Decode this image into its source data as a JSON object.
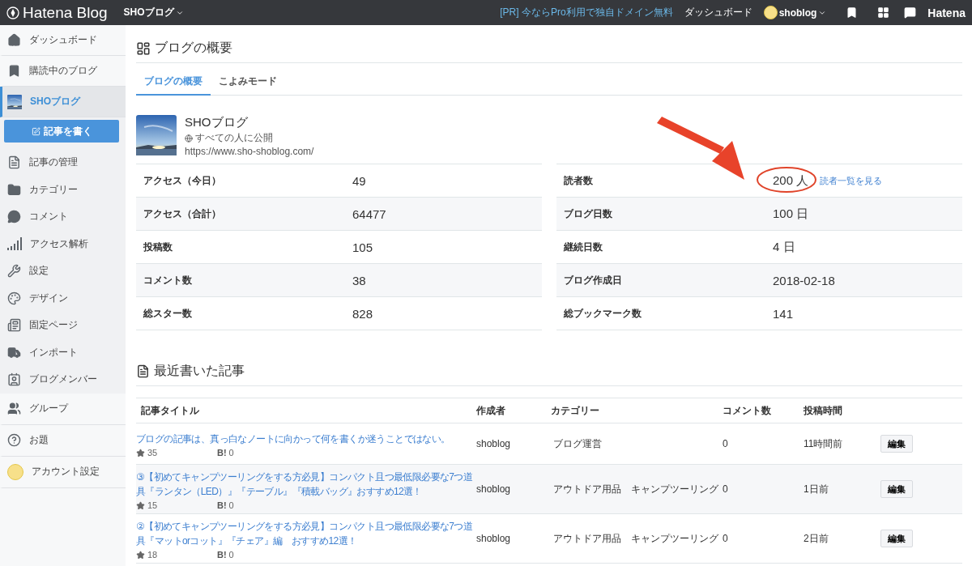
{
  "topbar": {
    "logo": "Hatena Blog",
    "blog_menu": "SHOブログ",
    "promo": "[PR] 今ならPro利用で独自ドメイン無料",
    "dashboard": "ダッシュボード",
    "user": "shoblog",
    "brand": "Hatena"
  },
  "sidebar": {
    "sections": [
      {
        "items": [
          {
            "label": "ダッシュボード",
            "kind": "link",
            "selected": false
          },
          {
            "label": "購読中のブログ",
            "kind": "link",
            "selected": false
          }
        ]
      },
      {
        "items": [
          {
            "label": "SHOブログ",
            "kind": "blog",
            "selected": true
          },
          {
            "label": "記事を書く",
            "kind": "button"
          },
          {
            "label": "記事の管理",
            "kind": "link",
            "selected": false
          },
          {
            "label": "カテゴリー",
            "kind": "link",
            "selected": false
          },
          {
            "label": "コメント",
            "kind": "link",
            "selected": false
          },
          {
            "label": "アクセス解析",
            "kind": "link",
            "selected": false
          },
          {
            "label": "設定",
            "kind": "link",
            "selected": false
          },
          {
            "label": "デザイン",
            "kind": "link",
            "selected": false
          },
          {
            "label": "固定ページ",
            "kind": "link",
            "selected": false
          },
          {
            "label": "インポート",
            "kind": "link",
            "selected": false
          },
          {
            "label": "ブログメンバー",
            "kind": "link",
            "selected": false
          }
        ]
      },
      {
        "items": [
          {
            "label": "グループ",
            "kind": "link",
            "selected": false
          },
          {
            "label": "お題",
            "kind": "link",
            "selected": false
          },
          {
            "label": "アカウント設定",
            "kind": "account",
            "selected": false
          }
        ]
      }
    ]
  },
  "overview": {
    "title": "ブログの概要",
    "tabs": [
      {
        "label": "ブログの概要",
        "selected": true
      },
      {
        "label": "こよみモード",
        "selected": false
      }
    ],
    "blog": {
      "name": "SHOブログ",
      "visibility": "すべての人に公開",
      "url": "https://www.sho-shoblog.com/"
    },
    "stats_left": [
      {
        "label": "アクセス（今日）",
        "value": "49"
      },
      {
        "label": "アクセス（合計）",
        "value": "64477"
      },
      {
        "label": "投稿数",
        "value": "105"
      },
      {
        "label": "コメント数",
        "value": "38"
      },
      {
        "label": "総スター数",
        "value": "828"
      }
    ],
    "stats_right": [
      {
        "label": "読者数",
        "value": "200 人",
        "link": "読者一覧を見る",
        "highlighted": true
      },
      {
        "label": "ブログ日数",
        "value": "100 日",
        "highlighted": false
      },
      {
        "label": "継続日数",
        "value": "4 日",
        "highlighted": false
      },
      {
        "label": "ブログ作成日",
        "value": "2018-02-18",
        "highlighted": false
      },
      {
        "label": "総ブックマーク数",
        "value": "141",
        "highlighted": false
      }
    ]
  },
  "recent": {
    "title": "最近書いた記事",
    "columns": [
      "記事タイトル",
      "作成者",
      "カテゴリー",
      "コメント数",
      "投稿時間"
    ],
    "rows": [
      {
        "title": "ブログの記事は、真っ白なノートに向かって何を書くか迷うことではない。",
        "stars": "35",
        "bookmark_mark": "B!",
        "bookmarks": "0",
        "author": "shoblog",
        "category": "ブログ運営",
        "comments": "0",
        "time": "11時間前",
        "action": "編集"
      },
      {
        "title": "③【初めてキャンプツーリングをする方必見】コンパクト且つ最低限必要な7つ道具『ランタン（LED）』『テーブル』『積載バッグ』おすすめ12選！",
        "stars": "15",
        "bookmark_mark": "B!",
        "bookmarks": "0",
        "author": "shoblog",
        "category": "アウトドア用品　キャンプツーリング",
        "comments": "0",
        "time": "1日前",
        "action": "編集"
      },
      {
        "title": "②【初めてキャンプツーリングをする方必見】コンパクト且つ最低限必要な7つ道具『マットorコット』『チェア』編　おすすめ12選！",
        "stars": "18",
        "bookmark_mark": "B!",
        "bookmarks": "0",
        "author": "shoblog",
        "category": "アウトドア用品　キャンプツーリング",
        "comments": "0",
        "time": "2日前",
        "action": "編集"
      }
    ]
  }
}
